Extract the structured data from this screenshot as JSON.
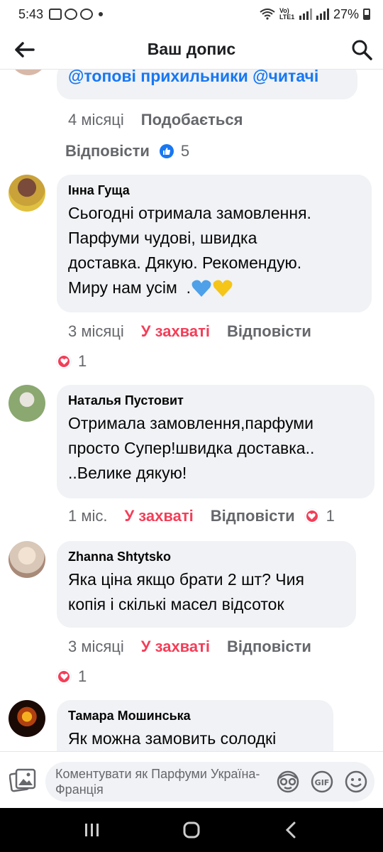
{
  "status_bar": {
    "time": "5:43",
    "network_label": "Vo) LTE1",
    "battery": "27%"
  },
  "header": {
    "title": "Ваш допис"
  },
  "prev_comment": {
    "mentions": "@топові прихильники @читачі",
    "time": "4 місяці",
    "like_label": "Подобається",
    "reply_label": "Відповісти",
    "reaction_count": "5"
  },
  "comments": [
    {
      "author": "Інна Гуща",
      "text_lines": [
        "Сьогодні отримала замовлення.",
        "Парфуми чудові, швидка",
        "доставка. Дякую. Рекомендую.",
        "Миру нам усім  ."
      ],
      "time": "3 місяці",
      "react_label": "У захваті",
      "reply_label": "Відповісти",
      "reaction_count": "1"
    },
    {
      "author": "Наталья Пустовит",
      "text_lines": [
        "Отримала замовлення,парфуми",
        "просто Супер!швидка доставка..",
        "..Велике дякую!"
      ],
      "time": "1 міс.",
      "react_label": "У захваті",
      "reply_label": "Відповісти",
      "reaction_count": "1"
    },
    {
      "author": "Zhanna  Shtytsko",
      "text_lines": [
        "Яка ціна якщо брати 2 шт? Чия",
        "копія і скількі масел відсоток"
      ],
      "time": "3 місяці",
      "react_label": "У захваті",
      "reply_label": "Відповісти",
      "reaction_count": "1"
    },
    {
      "author": "Тамара Мошинська",
      "text_lines": [
        "Як можна замовить солодкі"
      ]
    }
  ],
  "composer": {
    "placeholder": "Коментувати як Парфуми Україна-Франція"
  },
  "colors": {
    "accent": "#1877f2",
    "love": "#f33e58",
    "bubble": "#f0f2f5",
    "meta": "#65676b"
  }
}
